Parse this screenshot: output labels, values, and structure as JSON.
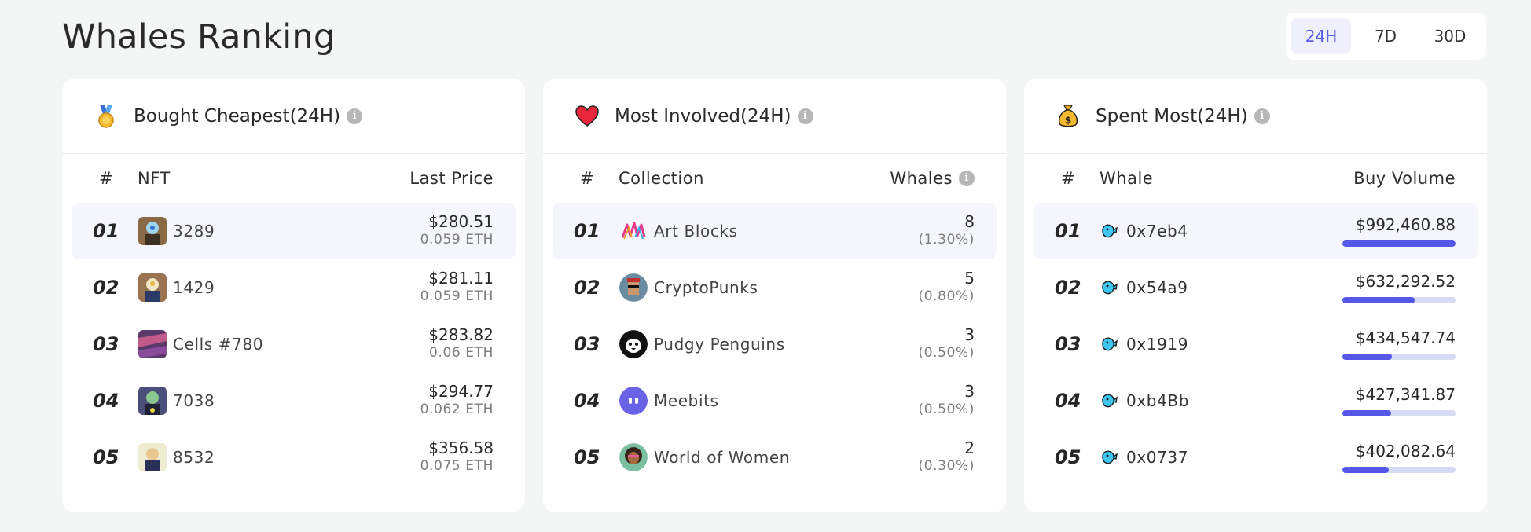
{
  "header": {
    "title": "Whales Ranking",
    "periods": [
      "24H",
      "7D",
      "30D"
    ],
    "active_period": "24H"
  },
  "cards": {
    "cheapest": {
      "title": "Bought Cheapest(24H)",
      "col_rank": "#",
      "col_name": "NFT",
      "col_value": "Last Price",
      "rows": [
        {
          "rank": "01",
          "name": "3289",
          "price": "$280.51",
          "eth": "0.059 ETH"
        },
        {
          "rank": "02",
          "name": "1429",
          "price": "$281.11",
          "eth": "0.059 ETH"
        },
        {
          "rank": "03",
          "name": "Cells #780",
          "price": "$283.82",
          "eth": "0.06 ETH"
        },
        {
          "rank": "04",
          "name": "7038",
          "price": "$294.77",
          "eth": "0.062 ETH"
        },
        {
          "rank": "05",
          "name": "8532",
          "price": "$356.58",
          "eth": "0.075 ETH"
        }
      ]
    },
    "involved": {
      "title": "Most Involved(24H)",
      "col_rank": "#",
      "col_name": "Collection",
      "col_value": "Whales",
      "rows": [
        {
          "rank": "01",
          "name": "Art Blocks",
          "count": "8",
          "pct": "(1.30%)"
        },
        {
          "rank": "02",
          "name": "CryptoPunks",
          "count": "5",
          "pct": "(0.80%)"
        },
        {
          "rank": "03",
          "name": "Pudgy Penguins",
          "count": "3",
          "pct": "(0.50%)"
        },
        {
          "rank": "04",
          "name": "Meebits",
          "count": "3",
          "pct": "(0.50%)"
        },
        {
          "rank": "05",
          "name": "World of Women",
          "count": "2",
          "pct": "(0.30%)"
        }
      ]
    },
    "spent": {
      "title": "Spent Most(24H)",
      "col_rank": "#",
      "col_name": "Whale",
      "col_value": "Buy Volume",
      "rows": [
        {
          "rank": "01",
          "name": "0x7eb4",
          "volume": "$992,460.88",
          "fill": 1.0
        },
        {
          "rank": "02",
          "name": "0x54a9",
          "volume": "$632,292.52",
          "fill": 0.64
        },
        {
          "rank": "03",
          "name": "0x1919",
          "volume": "$434,547.74",
          "fill": 0.44
        },
        {
          "rank": "04",
          "name": "0xb4Bb",
          "volume": "$427,341.87",
          "fill": 0.43
        },
        {
          "rank": "05",
          "name": "0x0737",
          "volume": "$402,082.64",
          "fill": 0.41
        }
      ]
    }
  },
  "colors": {
    "accent": "#5457e8",
    "bar_track": "#d7daf5",
    "active_bg": "#eef0fb",
    "row_highlight": "#f4f5fd"
  },
  "icons": {
    "cheapest_card": "medal-icon",
    "involved_card": "heart-icon",
    "spent_card": "money-bag-icon",
    "info": "info-icon",
    "whale": "whale-icon"
  }
}
